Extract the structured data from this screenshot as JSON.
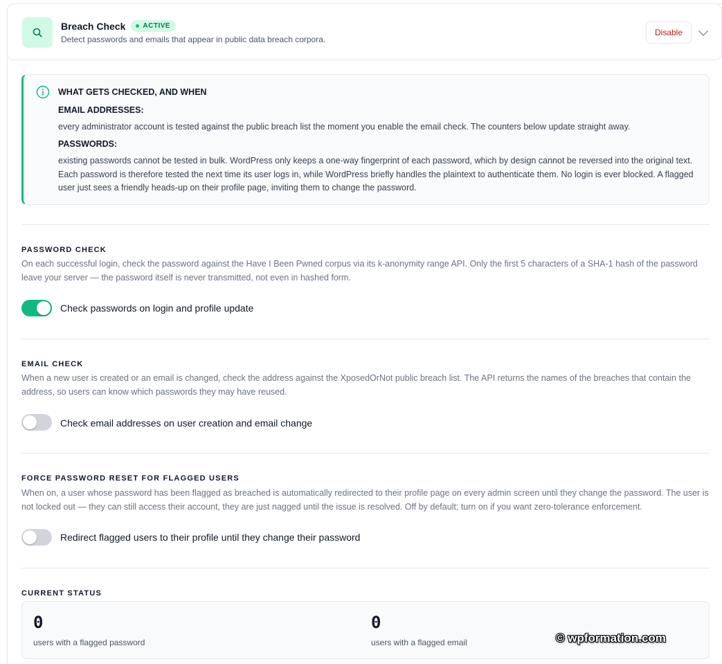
{
  "header": {
    "title": "Breach Check",
    "badge": "ACTIVE",
    "description": "Detect passwords and emails that appear in public data breach corpora.",
    "disable_label": "Disable",
    "icon": "search-icon"
  },
  "info": {
    "title": "WHAT GETS CHECKED, AND WHEN",
    "email_heading": "EMAIL ADDRESSES:",
    "email_text": "every administrator account is tested against the public breach list the moment you enable the email check. The counters below update straight away.",
    "password_heading": "PASSWORDS:",
    "password_text": "existing passwords cannot be tested in bulk. WordPress only keeps a one-way fingerprint of each password, which by design cannot be reversed into the original text. Each password is therefore tested the next time its user logs in, while WordPress briefly handles the plaintext to authenticate them. No login is ever blocked. A flagged user just sees a friendly heads-up on their profile page, inviting them to change the password."
  },
  "sections": {
    "password_check": {
      "title": "PASSWORD CHECK",
      "description": "On each successful login, check the password against the Have I Been Pwned corpus via its k-anonymity range API. Only the first 5 characters of a SHA-1 hash of the password leave your server — the password itself is never transmitted, not even in hashed form.",
      "toggle_label": "Check passwords on login and profile update",
      "enabled": true
    },
    "email_check": {
      "title": "EMAIL CHECK",
      "description": "When a new user is created or an email is changed, check the address against the XposedOrNot public breach list. The API returns the names of the breaches that contain the address, so users can know which passwords they may have reused.",
      "toggle_label": "Check email addresses on user creation and email change",
      "enabled": false
    },
    "force_reset": {
      "title": "FORCE PASSWORD RESET FOR FLAGGED USERS",
      "description": "When on, a user whose password has been flagged as breached is automatically redirected to their profile page on every admin screen until they change the password. The user is not locked out — they can still access their account, they are just nagged until the issue is resolved. Off by default; turn on if you want zero-tolerance enforcement.",
      "toggle_label": "Redirect flagged users to their profile until they change their password",
      "enabled": false
    }
  },
  "status": {
    "title": "CURRENT STATUS",
    "flagged_password_count": "0",
    "flagged_password_label": "users with a flagged password",
    "flagged_email_count": "0",
    "flagged_email_label": "users with a flagged email"
  },
  "watermark": "© wpformation.com",
  "colors": {
    "accent": "#10b981",
    "accent_light": "#d1fae5",
    "danger": "#b91c1c",
    "toggle_off": "#d1d5db"
  }
}
